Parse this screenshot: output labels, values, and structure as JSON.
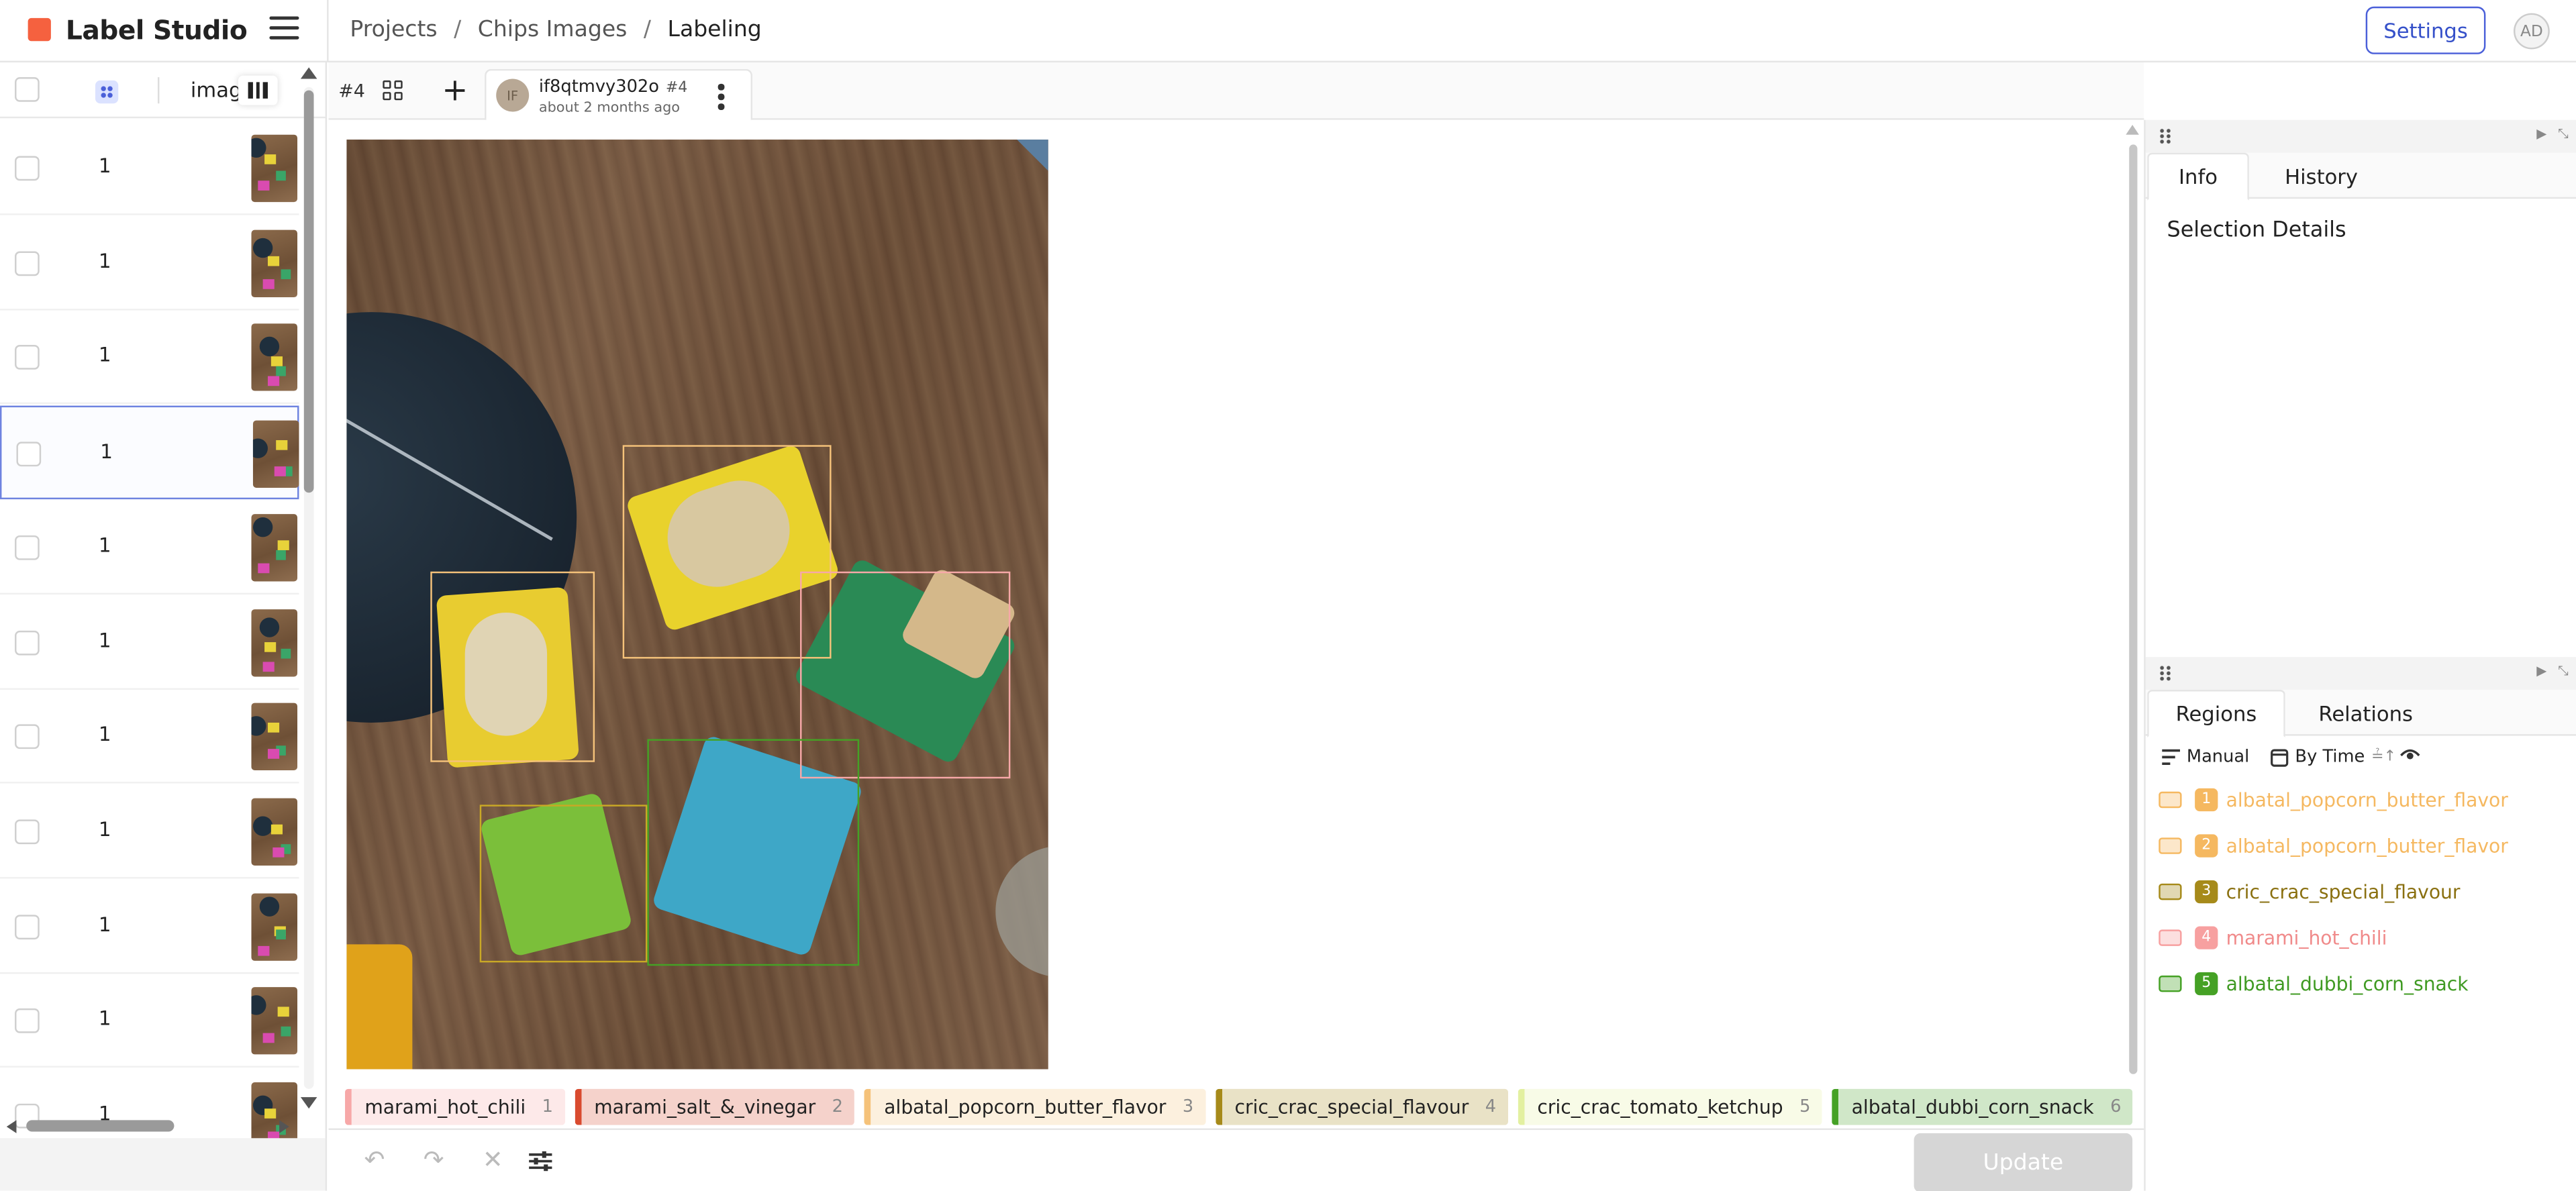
{
  "app": {
    "name": "Label Studio"
  },
  "breadcrumb": {
    "projects": "Projects",
    "sep": "/",
    "project": "Chips Images",
    "current": "Labeling"
  },
  "header": {
    "settings": "Settings",
    "user_initials": "AD"
  },
  "task_list": {
    "column": "image",
    "rows": [
      {
        "value": "1"
      },
      {
        "value": "1"
      },
      {
        "value": "1"
      },
      {
        "value": "1",
        "selected": true
      },
      {
        "value": "1"
      },
      {
        "value": "1"
      },
      {
        "value": "1"
      },
      {
        "value": "1"
      },
      {
        "value": "1"
      },
      {
        "value": "1"
      },
      {
        "value": "1"
      }
    ]
  },
  "task_tabs": {
    "task_id": "#4",
    "annotation": {
      "user": "if8qtmvy302o",
      "avatar": "IF",
      "number": "#4",
      "time": "about 2 months ago"
    }
  },
  "labels": [
    {
      "name": "marami_hot_chili",
      "key": "1",
      "color": "#f7a8a8"
    },
    {
      "name": "marami_salt_&_vinegar",
      "key": "2",
      "color": "#d94b2f"
    },
    {
      "name": "albatal_popcorn_butter_flavor",
      "key": "3",
      "color": "#f5c27a"
    },
    {
      "name": "cric_crac_special_flavour",
      "key": "4",
      "color": "#a68a1a"
    },
    {
      "name": "cric_crac_tomato_ketchup",
      "key": "5",
      "color": "#e3f0a0"
    },
    {
      "name": "albatal_dubbi_corn_snack",
      "key": "6",
      "color": "#45a125"
    }
  ],
  "bottom": {
    "update": "Update"
  },
  "right_panel": {
    "tabs": [
      "Info",
      "History"
    ],
    "selection_details": "Selection Details",
    "tabs2": [
      "Regions",
      "Relations"
    ],
    "filters": {
      "manual": "Manual",
      "by_time": "By Time"
    },
    "regions": [
      {
        "idx": "1",
        "label": "albatal_popcorn_butter_flavor",
        "color": "#f5b860",
        "text_color": "#f5b860"
      },
      {
        "idx": "2",
        "label": "albatal_popcorn_butter_flavor",
        "color": "#f5b860",
        "text_color": "#f5b860"
      },
      {
        "idx": "3",
        "label": "cric_crac_special_flavour",
        "color": "#a68a1a",
        "text_color": "#8a7010"
      },
      {
        "idx": "4",
        "label": "marami_hot_chili",
        "color": "#f7a0a0",
        "text_color": "#f08a8a"
      },
      {
        "idx": "5",
        "label": "albatal_dubbi_corn_snack",
        "color": "#45a125",
        "text_color": "#3f9a22"
      }
    ]
  }
}
